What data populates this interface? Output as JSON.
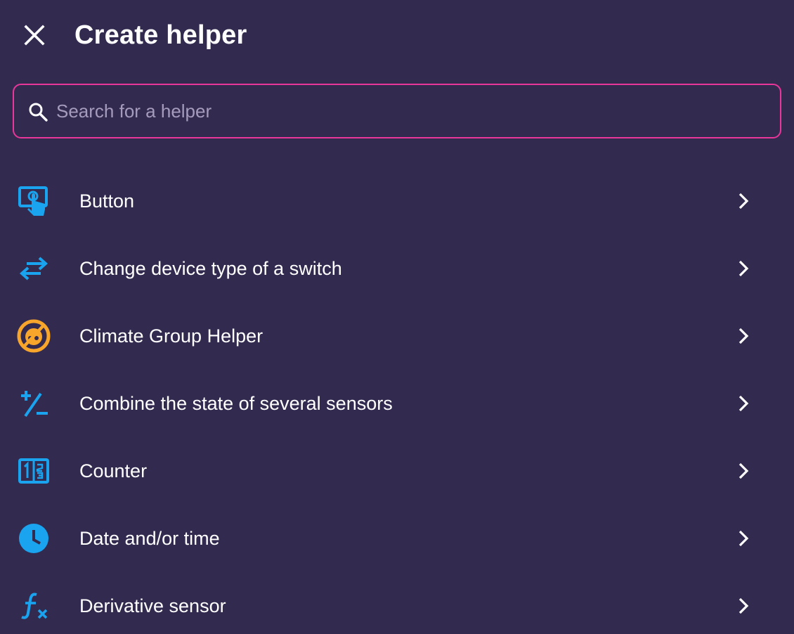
{
  "dialog": {
    "title": "Create helper",
    "close_icon": "close-icon"
  },
  "search": {
    "placeholder": "Search for a helper",
    "value": "",
    "icon": "search-icon"
  },
  "items": [
    {
      "label": "Button",
      "icon": "button-tap-icon",
      "icon_color": "#1aa3ee"
    },
    {
      "label": "Change device type of a switch",
      "icon": "swap-arrows-icon",
      "icon_color": "#1aa3ee"
    },
    {
      "label": "Climate Group Helper",
      "icon": "climate-group-icon",
      "icon_color": "#f7a52b"
    },
    {
      "label": "Combine the state of several sensors",
      "icon": "plus-minus-icon",
      "icon_color": "#1aa3ee"
    },
    {
      "label": "Counter",
      "icon": "counter-icon",
      "icon_color": "#1aa3ee"
    },
    {
      "label": "Date and/or time",
      "icon": "clock-icon",
      "icon_color": "#1aa3ee"
    },
    {
      "label": "Derivative sensor",
      "icon": "function-icon",
      "icon_color": "#1aa3ee"
    }
  ],
  "colors": {
    "background": "#332a4f",
    "accent": "#e8369a",
    "icon_blue": "#1aa3ee",
    "icon_orange": "#f7a52b",
    "placeholder": "#a59bbd"
  }
}
